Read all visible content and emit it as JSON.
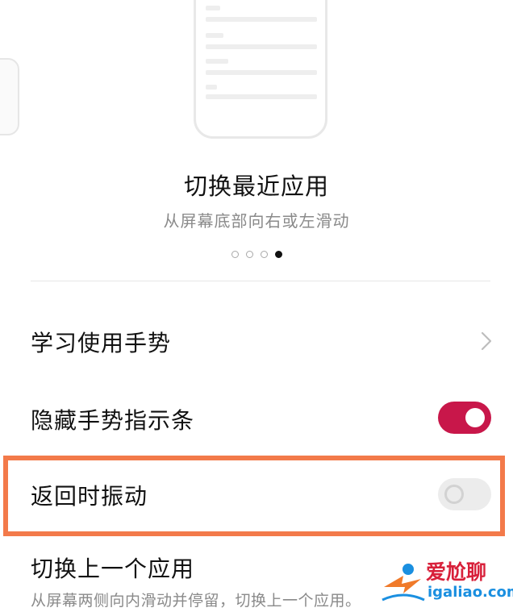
{
  "gesture_card": {
    "title": "切换最近应用",
    "subtitle": "从屏幕底部向右或左滑动",
    "page_count": 4,
    "active_page": 4
  },
  "settings": {
    "learn_gestures": {
      "label": "学习使用手势",
      "icon": "chevron-right-icon"
    },
    "hide_gesture_bar": {
      "label": "隐藏手势指示条",
      "enabled": true
    },
    "vibrate_on_back": {
      "label": "返回时振动",
      "enabled": false
    },
    "switch_previous_app": {
      "label": "切换上一个应用",
      "description": "从屏幕两侧向内滑动并停留，切换上一个应用。"
    }
  },
  "watermark": {
    "text": "爱尬聊",
    "url": "igaliao.com"
  },
  "colors": {
    "toggle_on": "#c8174a",
    "toggle_off": "#ececec",
    "highlight_border": "#f37a4a"
  }
}
